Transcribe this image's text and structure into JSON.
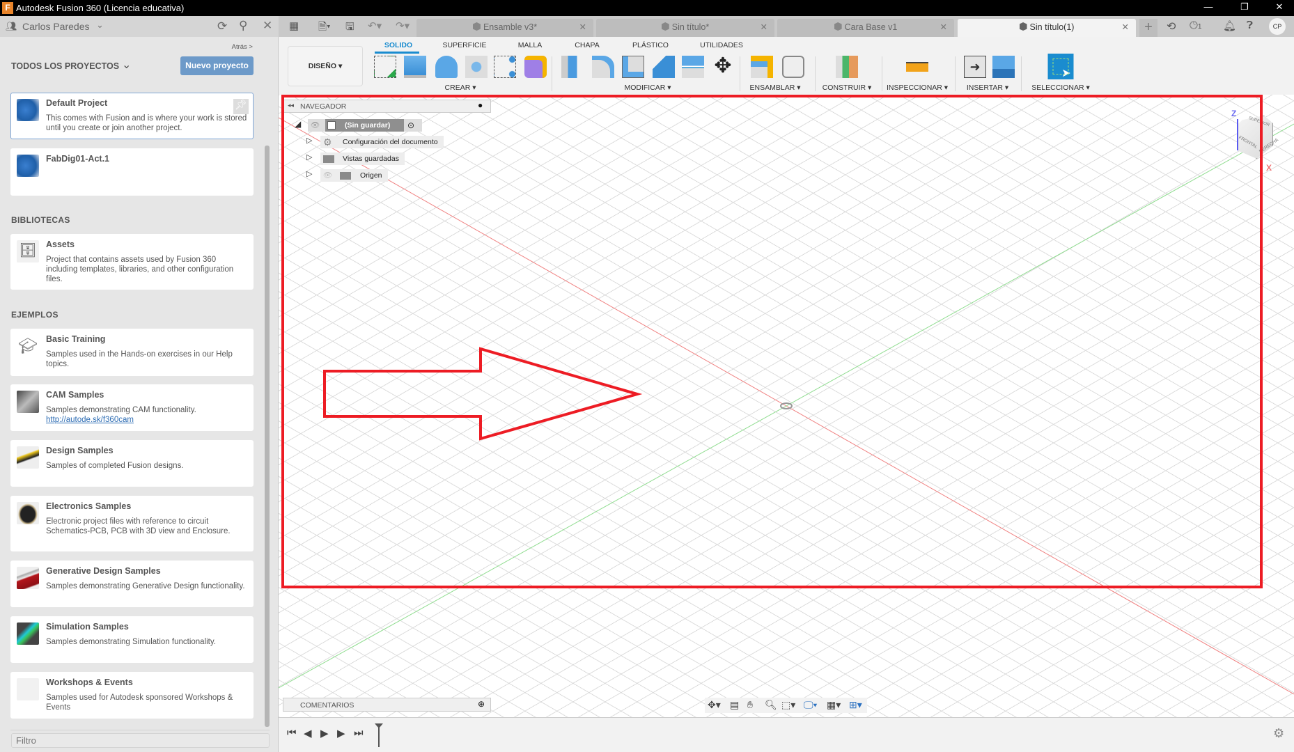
{
  "window": {
    "title": "Autodesk Fusion 360 (Licencia educativa)",
    "logo": "F",
    "controls": [
      "—",
      "❐",
      "✕"
    ]
  },
  "sidebar": {
    "user": "Carlos Paredes",
    "back": "Atrás >",
    "projects_heading": "TODOS LOS PROYECTOS",
    "new_project": "Nuevo proyecto",
    "projects": [
      {
        "name": "Default Project",
        "desc": "This comes with Fusion and is where your work is stored until you create or join another project."
      },
      {
        "name": "FabDig01-Act.1",
        "desc": ""
      }
    ],
    "libraries_heading": "BIBLIOTECAS",
    "libraries": [
      {
        "name": "Assets",
        "desc": "Project that contains assets used by Fusion 360 including templates, libraries, and other configuration files."
      }
    ],
    "examples_heading": "EJEMPLOS",
    "examples": [
      {
        "name": "Basic Training",
        "desc": "Samples used in the Hands-on exercises in our Help topics."
      },
      {
        "name": "CAM Samples",
        "desc": "Samples demonstrating CAM functionality.",
        "link": "http://autode.sk/f360cam"
      },
      {
        "name": "Design Samples",
        "desc": "Samples of completed Fusion designs."
      },
      {
        "name": "Electronics Samples",
        "desc": "Electronic project files with reference to circuit Schematics-PCB, PCB with 3D view and Enclosure."
      },
      {
        "name": "Generative Design Samples",
        "desc": "Samples demonstrating Generative Design functionality."
      },
      {
        "name": "Simulation Samples",
        "desc": "Samples demonstrating Simulation functionality."
      },
      {
        "name": "Workshops & Events",
        "desc": "Samples used for Autodesk sponsored Workshops & Events"
      }
    ],
    "filter_placeholder": "Filtro"
  },
  "tabs": [
    {
      "label": "Ensamble v3*"
    },
    {
      "label": "Sin título*"
    },
    {
      "label": "Cara Base v1"
    },
    {
      "label": "Sin título(1)",
      "active": true
    }
  ],
  "header_right": {
    "jobs_count": "1",
    "avatar": "CP"
  },
  "toolbar": {
    "workspace": "DISEÑO ▾",
    "tabs": [
      "SOLIDO",
      "SUPERFICIE",
      "MALLA",
      "CHAPA",
      "PLÁSTICO",
      "UTILIDADES"
    ],
    "groups": [
      "CREAR ▾",
      "MODIFICAR ▾",
      "ENSAMBLAR ▾",
      "CONSTRUIR ▾",
      "INSPECCIONAR ▾",
      "INSERTAR ▾",
      "SELECCIONAR ▾"
    ]
  },
  "browser": {
    "title": "NAVEGADOR",
    "root": "(Sin guardar)",
    "items": [
      "Configuración del documento",
      "Vistas guardadas",
      "Origen"
    ]
  },
  "viewcube": {
    "top": "SUPERIOR",
    "front": "FRONTAL",
    "right": "DERECHA",
    "z": "Z",
    "x": "X"
  },
  "comments": {
    "title": "COMENTARIOS"
  },
  "colors": {
    "accent": "#1a8ccf",
    "highlight": "#ed1c24",
    "button": "#6d9ac9"
  }
}
